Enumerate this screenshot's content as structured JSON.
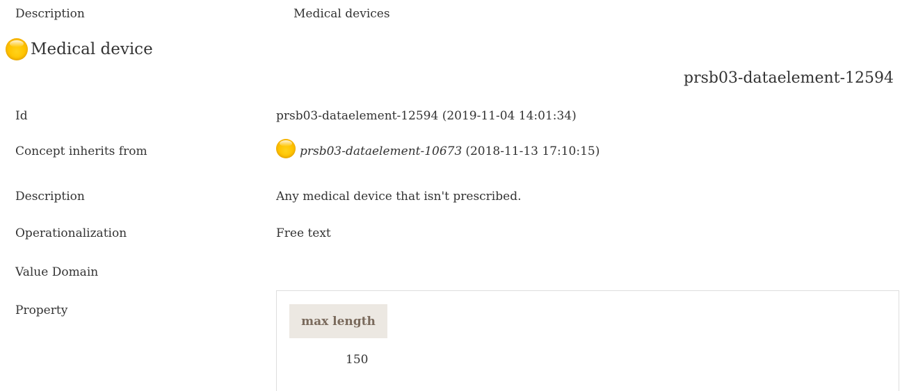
{
  "top": {
    "label": "Description",
    "value": "Medical devices"
  },
  "concept": {
    "title": "Medical device",
    "id_heading": "prsb03-dataelement-12594",
    "status_icon": "circle-yellow-icon"
  },
  "fields": {
    "id_label": "Id",
    "id_value": "prsb03-dataelement-12594 (2019-11-04 14:01:34)",
    "inherits_label": "Concept inherits from",
    "inherits_ref": "prsb03-dataelement-10673",
    "inherits_stamp": "(2018-11-13 17:10:15)",
    "description_label": "Description",
    "description_value": "Any medical device that isn't prescribed.",
    "operationalization_label": "Operationalization",
    "operationalization_value": "Free text",
    "value_domain_label": "Value Domain",
    "property_label": "Property"
  },
  "property_table": {
    "header": "max length",
    "value": "150"
  },
  "colors": {
    "status_yellow": "#ffc400",
    "header_bg": "#ece8e2",
    "header_text": "#7a6a5c"
  }
}
